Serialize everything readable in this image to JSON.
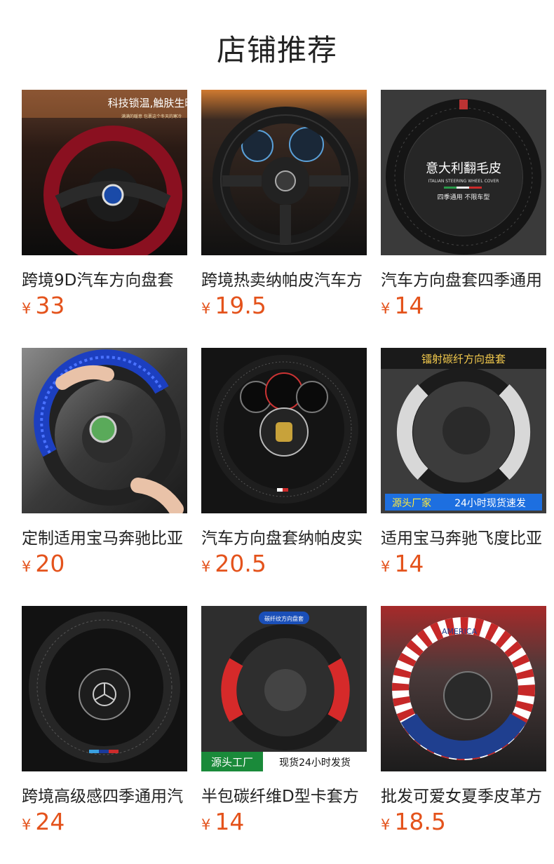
{
  "header": {
    "title": "店铺推荐"
  },
  "theme": {
    "price_color": "#e4531c"
  },
  "products": [
    {
      "name": "跨境9D汽车方向盘套",
      "currency": "¥",
      "price": "33",
      "image_icon": "steering-wheel-red-plush",
      "image_texts": {
        "headline": "科技锁温,触肤生暖",
        "sub": "满满的暖意 包裹这个冬天的寒冷"
      }
    },
    {
      "name": "跨境热卖纳帕皮汽车方",
      "currency": "¥",
      "price": "19.5",
      "image_icon": "steering-wheel-black-leather",
      "image_texts": {}
    },
    {
      "name": "汽车方向盘套四季通用",
      "currency": "¥",
      "price": "14",
      "image_icon": "steering-wheel-cover-suede",
      "image_texts": {
        "headline": "意大利翻毛皮",
        "sub": "ITALIAN STEERING WHEEL COVER",
        "tag": "四季通用  不限车型"
      }
    },
    {
      "name": "定制适用宝马奔驰比亚",
      "currency": "¥",
      "price": "20",
      "image_icon": "steering-wheel-blue-carbon",
      "image_texts": {}
    },
    {
      "name": "汽车方向盘套纳帕皮实",
      "currency": "¥",
      "price": "20.5",
      "image_icon": "steering-wheel-porsche",
      "image_texts": {}
    },
    {
      "name": "适用宝马奔驰飞度比亚",
      "currency": "¥",
      "price": "14",
      "image_icon": "steering-wheel-white-carbon",
      "image_texts": {
        "headline": "镭射碳纤方向盘套",
        "banner_a": "源头厂家",
        "banner_b": "24小时现货速发"
      }
    },
    {
      "name": "跨境高级感四季通用汽",
      "currency": "¥",
      "price": "24",
      "image_icon": "steering-wheel-mercedes",
      "image_texts": {}
    },
    {
      "name": "半包碳纤维D型卡套方",
      "currency": "¥",
      "price": "14",
      "image_icon": "steering-wheel-red-carbon",
      "image_texts": {
        "headline": "碳纤纹方向盘套",
        "banner_a": "源头工厂",
        "banner_b": "现货24小时发货"
      }
    },
    {
      "name": "批发可爱女夏季皮革方",
      "currency": "¥",
      "price": "18.5",
      "image_icon": "steering-wheel-usa-flag",
      "image_texts": {
        "headline": "AMERICA"
      }
    }
  ]
}
